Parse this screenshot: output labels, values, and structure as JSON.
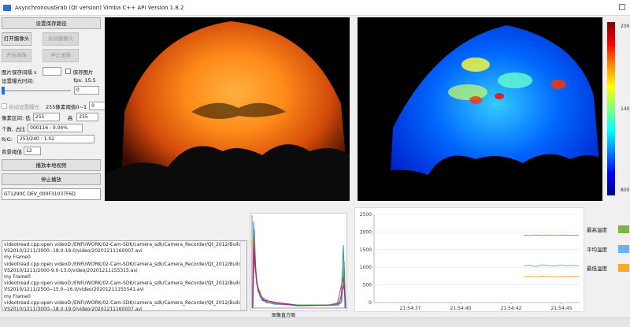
{
  "window": {
    "title": "AsynchronousGrab (Qt version) Vimba C++ API Version 1.8.2"
  },
  "left": {
    "set_path_button": "设置保存路径",
    "open_camera_button": "打开摄像头",
    "close_camera_button": "关闭摄像头",
    "start_record_button": "开始录像",
    "stop_record_button": "停止录像",
    "image_save_interval_label": "图片保存间隔 s",
    "save_image_label": "保存图片",
    "fps_label": "fps: 15.5",
    "exposure_time_label": "设置曝光时间:",
    "exposure_value": "0",
    "auto_exposure_label": "自动设置曝光",
    "gray_threshold_label": "255像素阈值0~1",
    "gray_threshold_value": "0",
    "pixel_range_label": "像素区间: 低",
    "pixel_low_value": "255",
    "pixel_high_label": "高",
    "pixel_high_value": "255",
    "count_label": "个数, 占比",
    "count_value": "000116 : 0.04%",
    "rg_label": "R/G:",
    "rg_value": "253/240 : 1.02",
    "bg_threshold_label": "背景阈值",
    "bg_threshold_value": "12",
    "play_local_button": "播放本地视频",
    "stop_play_button": "停止播放",
    "camera_id": "GT1290C DEV_000F31037F6D"
  },
  "colorbar": {
    "top_label": "2000",
    "mid_label": "1400",
    "bottom_label": "800"
  },
  "log": {
    "lines": [
      "videotread.cpp:open videoD:/ENFI/WORK/02-Cam-SDK/camera_sdk/Camera_Recorder/Qt_2012/Build/",
      "VS2010/1211/3000--18.0-19.0/video/20201211160007.avi",
      "my Frame0",
      "videotread.cpp:open videoD:/ENFI/WORK/02-Cam-SDK/camera_sdk/Camera_Recorder/Qt_2012/Build/",
      "VS2010/1211/2000-9.0-13.0/video/20201211155315.avi",
      "my Frame0",
      "videotread.cpp:open videoD:/ENFI/WORK/02-Cam-SDK/camera_sdk/Camera_Recorder/Qt_2012/Build/",
      "VS2010/1211/2500--15.0--16.0/video/20201211155541.avi",
      "my Frame0",
      "videotread.cpp:open videoD:/ENFI/WORK/02-Cam-SDK/camera_sdk/Camera_Recorder/Qt_2012/Build/",
      "VS2010/1211/3000--18.0-19.0/video/20201211160007.avi"
    ]
  },
  "histogram": {
    "title": "图像直方图"
  },
  "chart_data": {
    "type": "line",
    "x_ticks": [
      "21:54:37",
      "21:54:40",
      "21:54:42",
      "21:54:45"
    ],
    "ylim": [
      0,
      2500
    ],
    "y_ticks": [
      0,
      500,
      1000,
      1500,
      2000,
      2500
    ],
    "series": [
      {
        "name": "最高温度",
        "color": "#7cb342",
        "values": [
          1910,
          1905,
          1912,
          1908,
          1915,
          1905,
          1910,
          1912,
          1906,
          1910
        ]
      },
      {
        "name": "平均温度",
        "color": "#64b5f6",
        "values": [
          1040,
          1060,
          1020,
          1070,
          1050,
          1030,
          1065,
          1045,
          1055,
          1040
        ]
      },
      {
        "name": "最低温度",
        "color": "#ffa726",
        "values": [
          730,
          745,
          720,
          750,
          735,
          725,
          740,
          730,
          745,
          735
        ]
      }
    ]
  }
}
